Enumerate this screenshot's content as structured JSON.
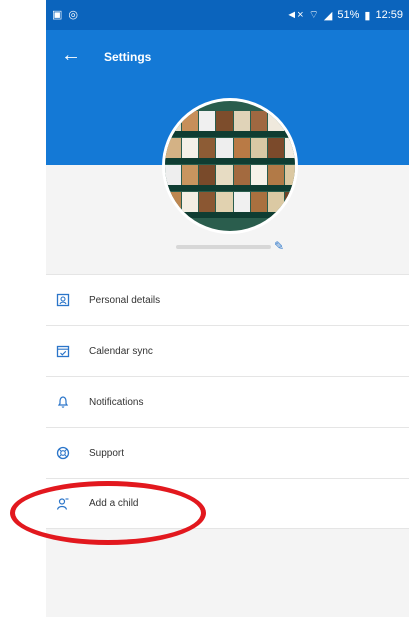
{
  "status": {
    "battery": "51%",
    "time": "12:59"
  },
  "header": {
    "title": "Settings"
  },
  "menu": [
    {
      "label": "Personal details",
      "icon": "id-card-icon"
    },
    {
      "label": "Calendar sync",
      "icon": "calendar-icon"
    },
    {
      "label": "Notifications",
      "icon": "bell-icon"
    },
    {
      "label": "Support",
      "icon": "lifebuoy-icon"
    },
    {
      "label": "Add a child",
      "icon": "user-icon"
    }
  ],
  "colors": {
    "header": "#1479d6",
    "status_bar": "#0b64bd",
    "icon_blue": "#2b75c9",
    "annotation": "#e2181e"
  }
}
